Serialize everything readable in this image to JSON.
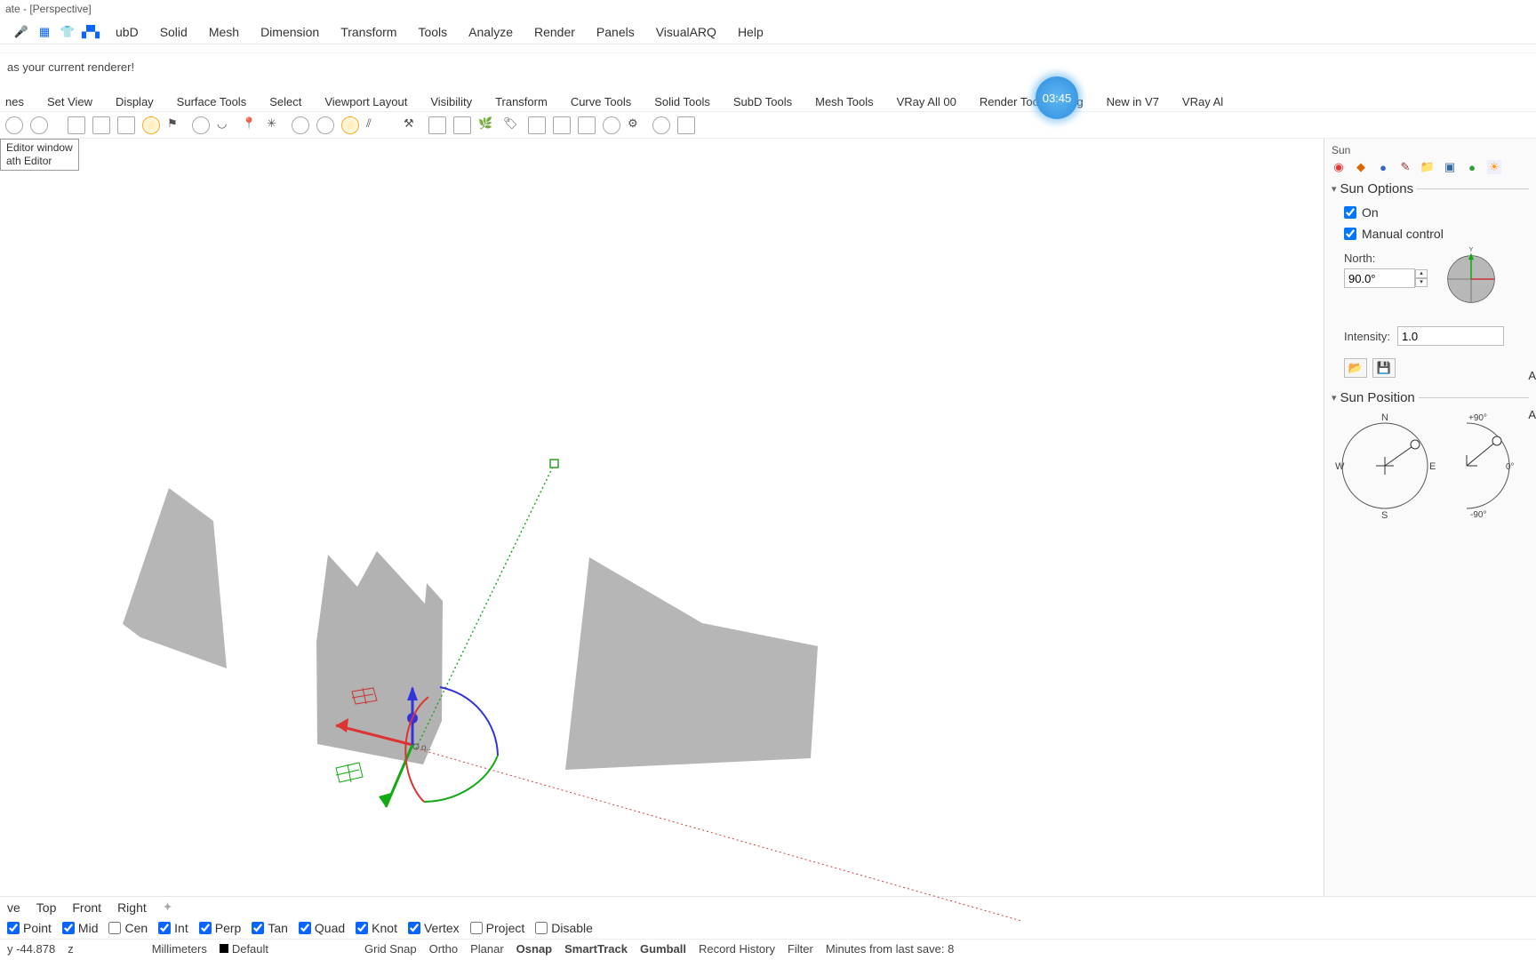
{
  "title": "ate - [Perspective]",
  "menubar": [
    "ubD",
    "Solid",
    "Mesh",
    "Dimension",
    "Transform",
    "Tools",
    "Analyze",
    "Render",
    "Panels",
    "VisualARQ",
    "Help"
  ],
  "command_line": "as your current renderer!",
  "tabs": [
    "nes",
    "Set View",
    "Display",
    "Surface Tools",
    "Select",
    "Viewport Layout",
    "Visibility",
    "Transform",
    "Curve Tools",
    "Solid Tools",
    "SubD Tools",
    "Mesh Tools",
    "VRay All 00",
    "Render Tools",
    "ng",
    "New in V7",
    "VRay Al"
  ],
  "time_badge": "03:45",
  "tooltip": {
    "line1": "Editor window",
    "line2": "ath Editor"
  },
  "side": {
    "title": "Sun",
    "sun_options_header": "Sun Options",
    "on_label": "On",
    "manual_label": "Manual control",
    "north_label": "North:",
    "north_value": "90.0°",
    "intensity_label": "Intensity:",
    "intensity_value": "1.0",
    "sun_position_header": "Sun Position",
    "compass_N": "N",
    "compass_S": "S",
    "compass_E": "E",
    "compass_W": "W",
    "alt_top": "+90°",
    "alt_mid": "0°",
    "alt_bot": "-90°",
    "cut_labels": {
      "a1": "A",
      "a2": "A"
    }
  },
  "viewbar": [
    "ve",
    "Top",
    "Front",
    "Right"
  ],
  "osnaps": [
    {
      "label": "Point",
      "checked": true
    },
    {
      "label": "Mid",
      "checked": true
    },
    {
      "label": "Cen",
      "checked": false
    },
    {
      "label": "Int",
      "checked": true
    },
    {
      "label": "Perp",
      "checked": true
    },
    {
      "label": "Tan",
      "checked": true
    },
    {
      "label": "Quad",
      "checked": true
    },
    {
      "label": "Knot",
      "checked": true
    },
    {
      "label": "Vertex",
      "checked": true
    },
    {
      "label": "Project",
      "checked": false
    },
    {
      "label": "Disable",
      "checked": false
    }
  ],
  "statusbar": {
    "coord_y": "y -44.878",
    "z_label": "z",
    "units": "Millimeters",
    "layer": "Default",
    "gridsnap": "Grid Snap",
    "ortho": "Ortho",
    "planar": "Planar",
    "osnap": "Osnap",
    "smarttrack": "SmartTrack",
    "gumball": "Gumball",
    "record_history": "Record History",
    "filter": "Filter",
    "lastsave": "Minutes from last save: 8"
  }
}
